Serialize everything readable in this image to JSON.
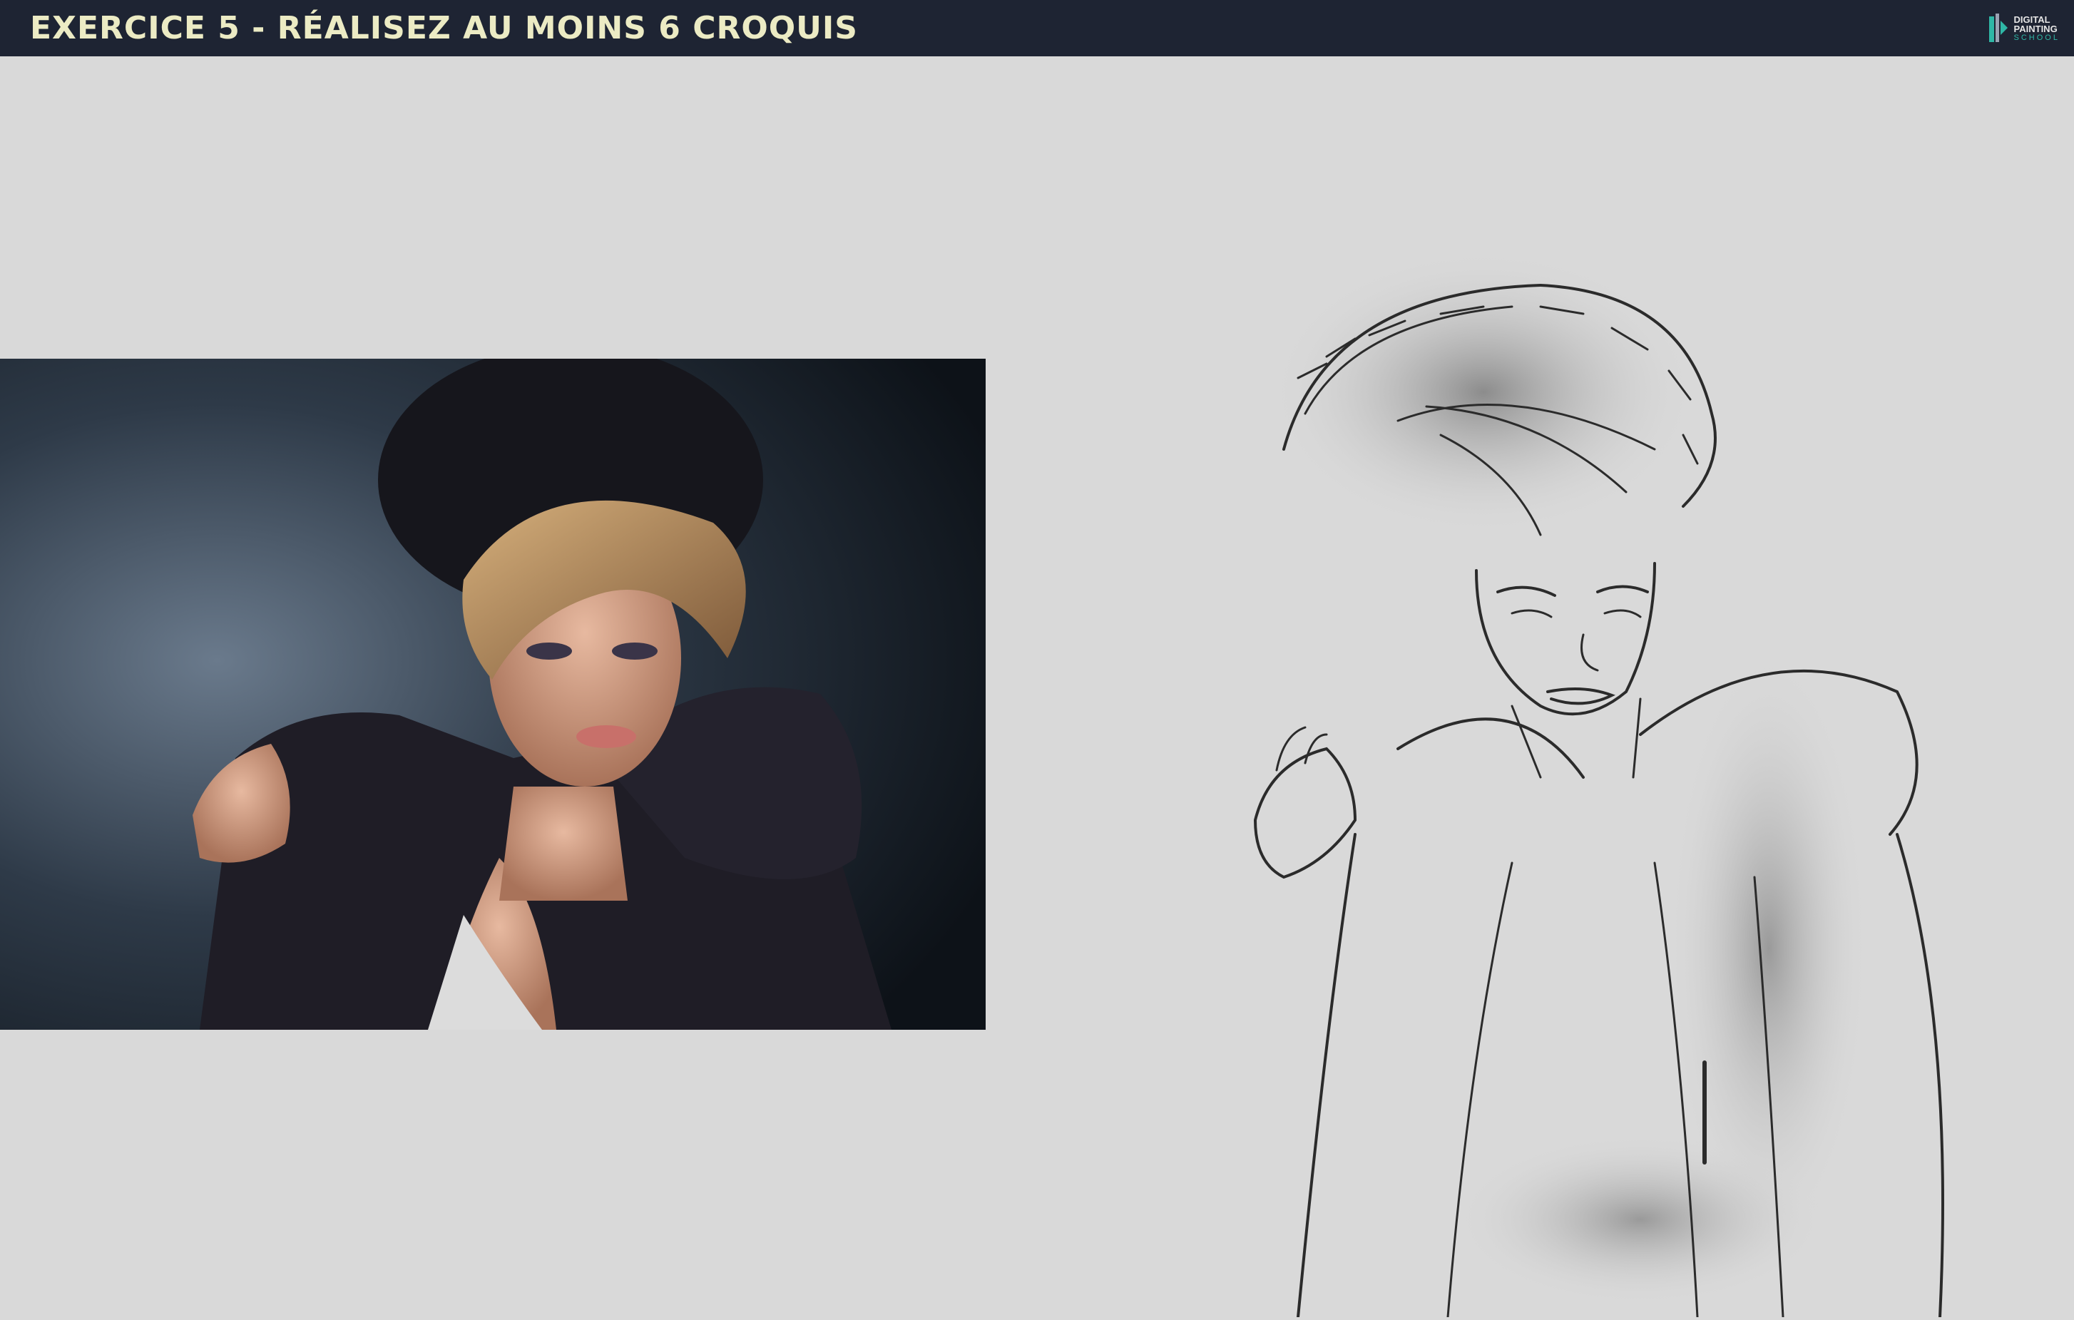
{
  "header": {
    "title": "EXERCICE 5 - RÉALISEZ AU MOINS 6 CROQUIS",
    "logo": {
      "line1": "DIGITAL",
      "line2": "PAINTING",
      "line3": "SCHOOL",
      "icon": "brush-logo-icon"
    }
  },
  "colors": {
    "topbar": "#1e2433",
    "title": "#ecebc4",
    "canvas": "#d9d9d9",
    "logo_accent": "#2fb7a6"
  },
  "images": {
    "reference_photo": "fashion portrait of a woman in a black fur hood and jacket",
    "sketch": "grayscale pencil sketch study of the reference portrait"
  }
}
